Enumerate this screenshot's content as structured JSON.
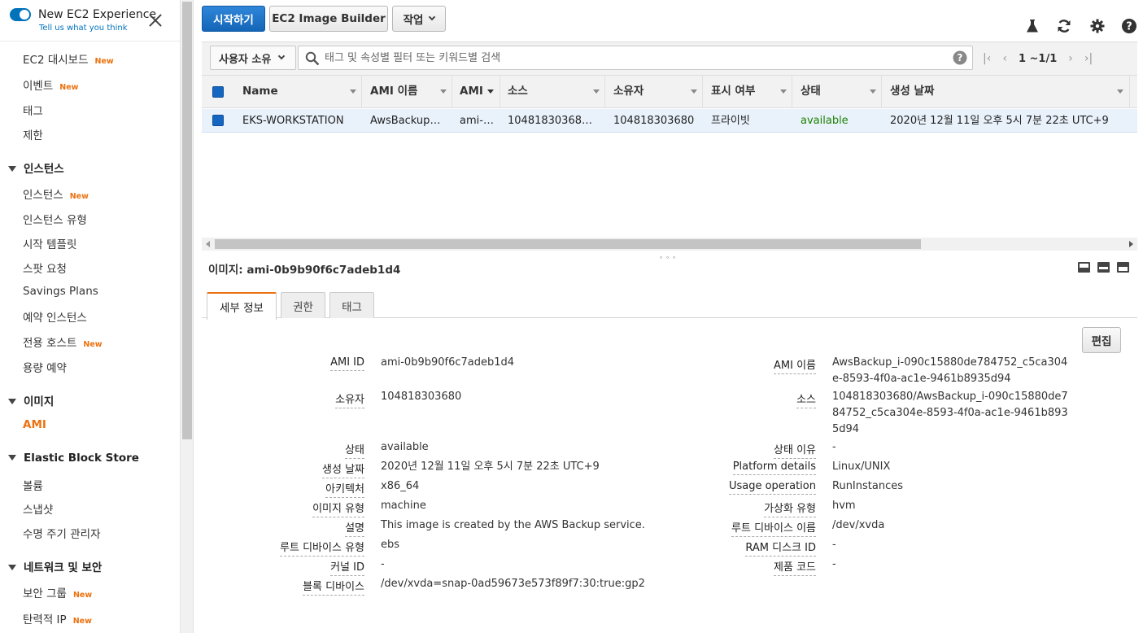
{
  "sidebar": {
    "experience_title": "New EC2 Experience",
    "experience_sub": "Tell us what you think",
    "new_badge": "New",
    "items_top": [
      {
        "label": "EC2 대시보드",
        "new": true
      },
      {
        "label": "이벤트",
        "new": true
      },
      {
        "label": "태그",
        "new": false
      },
      {
        "label": "제한",
        "new": false
      }
    ],
    "sections": {
      "instances": "인스턴스",
      "images": "이미지",
      "ebs": "Elastic Block Store",
      "network": "네트워크 및 보안"
    },
    "instances_items": [
      {
        "label": "인스턴스",
        "new": true
      },
      {
        "label": "인스턴스 유형",
        "new": false
      },
      {
        "label": "시작 템플릿",
        "new": false
      },
      {
        "label": "스팟 요청",
        "new": false
      },
      {
        "label": "Savings Plans",
        "new": false
      },
      {
        "label": "예약 인스턴스",
        "new": false
      },
      {
        "label": "전용 호스트",
        "new": true
      },
      {
        "label": "용량 예약",
        "new": false
      }
    ],
    "images_items": [
      {
        "label": "AMI",
        "new": false
      }
    ],
    "ebs_items": [
      {
        "label": "볼륨",
        "new": false
      },
      {
        "label": "스냅샷",
        "new": false
      },
      {
        "label": "수명 주기 관리자",
        "new": false
      }
    ],
    "network_items": [
      {
        "label": "보안 그룹",
        "new": true
      },
      {
        "label": "탄력적 IP",
        "new": true
      }
    ]
  },
  "toolbar": {
    "launch": "시작하기",
    "image_builder": "EC2 Image Builder",
    "actions": "작업",
    "icons": [
      "flask-icon",
      "refresh-icon",
      "gear-icon",
      "help-icon"
    ]
  },
  "filter": {
    "owner": "사용자 소유",
    "search_placeholder": "태그 및 속성별 필터 또는 키워드별 검색",
    "pager": "1 ~1/1"
  },
  "table": {
    "columns": [
      "Name",
      "AMI 이름",
      "AMI",
      "소스",
      "소유자",
      "표시 여부",
      "상태",
      "생성 날짜"
    ],
    "rows": [
      [
        "EKS-WORKSTATION",
        "AwsBackup_i-090c15880de784752_c5ca304e-8593-4f0a-ac1e-9461b8935d94",
        "ami-0b9b90f6c7adeb1d4",
        "104818303680/AwsBackup_i-090c15880de784752",
        "104818303680",
        "프라이빗",
        "available",
        "2020년 12월 11일 오후 5시 7분 22초 UTC+9"
      ]
    ]
  },
  "details": {
    "title": "이미지: ami-0b9b90f6c7adeb1d4",
    "tabs": [
      "세부 정보",
      "권한",
      "태그"
    ],
    "edit": "편집",
    "left": [
      {
        "label": "AMI ID",
        "value": "ami-0b9b90f6c7adeb1d4"
      },
      {
        "label": "소유자",
        "value": "104818303680"
      },
      {
        "label": "상태",
        "value": "available"
      },
      {
        "label": "생성 날짜",
        "value": "2020년 12월 11일 오후 5시 7분 22초 UTC+9"
      },
      {
        "label": "아키텍처",
        "value": "x86_64"
      },
      {
        "label": "이미지 유형",
        "value": "machine"
      },
      {
        "label": "설명",
        "value": "This image is created by the AWS Backup service."
      },
      {
        "label": "루트 디바이스 유형",
        "value": "ebs"
      },
      {
        "label": "커널 ID",
        "value": "-"
      },
      {
        "label": "블록 디바이스",
        "value": "/dev/xvda=snap-0ad59673e573f89f7:30:true:gp2"
      }
    ],
    "right": [
      {
        "label": "AMI 이름",
        "value": "AwsBackup_i-090c15880de784752_c5ca304e-8593-4f0a-ac1e-9461b8935d94"
      },
      {
        "label": "소스",
        "value": "104818303680/AwsBackup_i-090c15880de784752_c5ca304e-8593-4f0a-ac1e-9461b8935d94"
      },
      {
        "label": "상태 이유",
        "value": "-"
      },
      {
        "label": "Platform details",
        "value": "Linux/UNIX"
      },
      {
        "label": "Usage operation",
        "value": "RunInstances"
      },
      {
        "label": "가상화 유형",
        "value": "hvm"
      },
      {
        "label": "루트 디바이스 이름",
        "value": "/dev/xvda"
      },
      {
        "label": "RAM 디스크 ID",
        "value": "-"
      },
      {
        "label": "제품 코드",
        "value": "-"
      }
    ]
  },
  "colors": {
    "accent": "#ec7211",
    "primary": "#1465b8",
    "link": "#0073bb",
    "available": "#1d8102"
  }
}
